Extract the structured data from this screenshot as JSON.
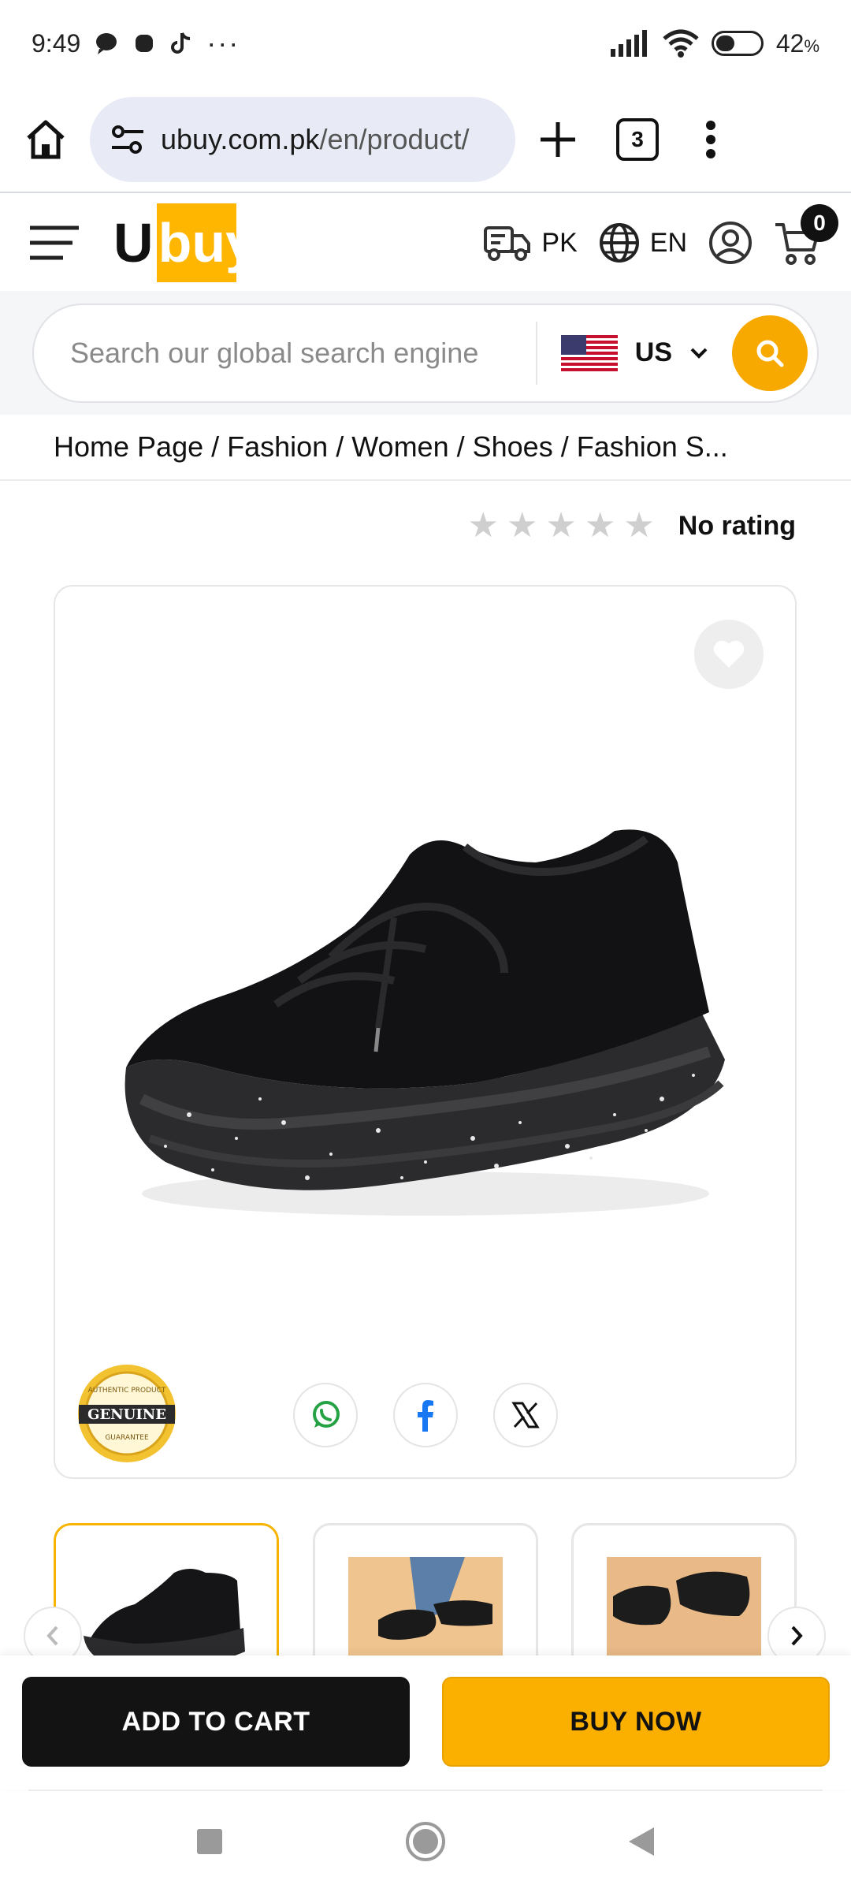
{
  "status_bar": {
    "time": "9:49",
    "more": "···",
    "battery_level": 0.42,
    "battery_text": "42",
    "battery_unit": "%"
  },
  "browser": {
    "url_domain": "ubuy.com.pk",
    "url_path": "/en/product/",
    "tab_count": "3"
  },
  "header": {
    "logo_first": "U",
    "logo_rest": "buy",
    "delivery_country": "PK",
    "language": "EN",
    "cart_count": "0"
  },
  "search": {
    "placeholder": "Search our global search engine",
    "country": "US"
  },
  "breadcrumb": {
    "items": [
      "Home Page",
      "Fashion",
      "Women",
      "Shoes",
      "Fashion S..."
    ],
    "separator": "/"
  },
  "rating": {
    "stars_filled": 0,
    "stars_total": 5,
    "text": "No rating"
  },
  "product": {
    "badge_text": "GENUINE",
    "badge_top": "AUTHENTIC PRODUCT",
    "badge_bottom": "GUARANTEE",
    "share": [
      "whatsapp-icon",
      "facebook-icon",
      "x-icon"
    ]
  },
  "actions": {
    "add_to_cart": "ADD TO CART",
    "buy_now": "BUY NOW"
  },
  "colors": {
    "accent": "#fbb000",
    "dark": "#131313"
  }
}
